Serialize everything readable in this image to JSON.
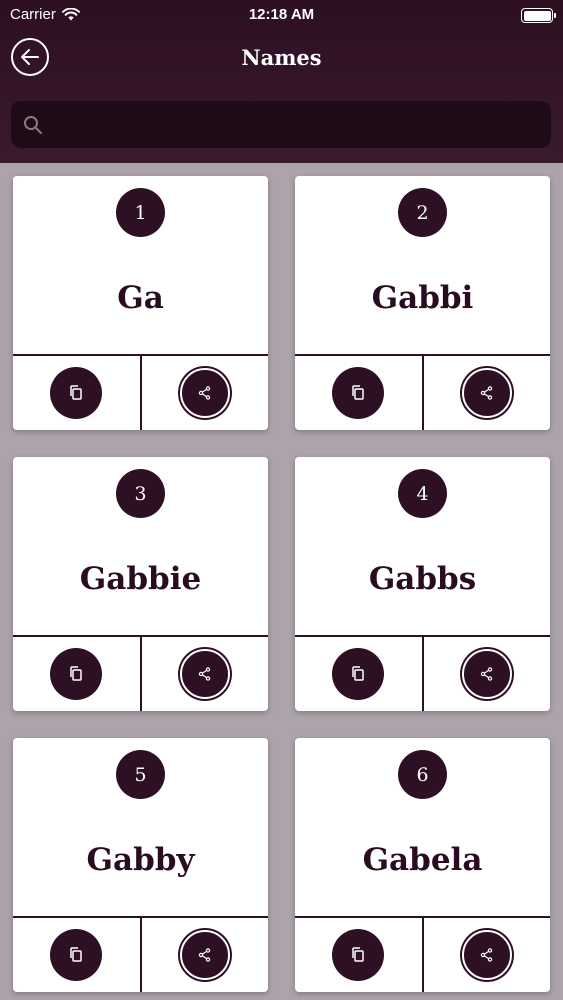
{
  "status": {
    "carrier": "Carrier",
    "time": "12:18 AM"
  },
  "nav": {
    "title": "Names"
  },
  "search": {
    "placeholder": "",
    "value": ""
  },
  "colors": {
    "primary": "#2e1025",
    "header": "#2d0f22",
    "background": "#ada3aa"
  },
  "cards": [
    {
      "number": "1",
      "name": "Ga"
    },
    {
      "number": "2",
      "name": "Gabbi"
    },
    {
      "number": "3",
      "name": "Gabbie"
    },
    {
      "number": "4",
      "name": "Gabbs"
    },
    {
      "number": "5",
      "name": "Gabby"
    },
    {
      "number": "6",
      "name": "Gabela"
    }
  ],
  "icons": {
    "back": "arrow-left-icon",
    "search": "search-icon",
    "copy": "copy-icon",
    "share": "share-icon"
  }
}
